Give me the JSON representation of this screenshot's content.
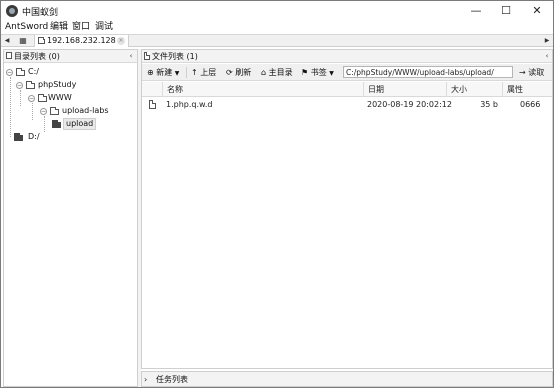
{
  "window": {
    "title": "中国蚁剑",
    "minimize": "—",
    "maximize": "☐",
    "close": "✕"
  },
  "menu": [
    "AntSword",
    "编辑",
    "窗口",
    "调试"
  ],
  "tabs": {
    "prev": "◀",
    "next": "▶",
    "home_icon": "▦",
    "active_label": "192.168.232.128",
    "close": "×"
  },
  "left_panel": {
    "title": "目录列表 (0)",
    "collapse": "‹",
    "tree": [
      {
        "label": "C:/",
        "toggle": "−"
      },
      {
        "label": "phpStudy",
        "toggle": "−"
      },
      {
        "label": "WWW",
        "toggle": "−"
      },
      {
        "label": "upload-labs",
        "toggle": "−"
      },
      {
        "label": "upload",
        "selected": true
      },
      {
        "label": "D:/"
      }
    ]
  },
  "right_panel": {
    "title": "文件列表 (1)",
    "collapse": "‹",
    "toolbar": {
      "new": "新建",
      "up": "上层",
      "refresh": "刷新",
      "home": "主目录",
      "bookmarks": "书签",
      "path": "C:/phpStudy/WWW/upload-labs/upload/",
      "read": "读取"
    },
    "columns": [
      "名称",
      "日期",
      "大小",
      "属性"
    ],
    "rows": [
      {
        "name": "1.php.q.w.d",
        "date": "2020-08-19 20:02:12",
        "size": "35 b",
        "attr": "0666"
      }
    ]
  },
  "task_panel": {
    "title": "任务列表",
    "expand": "›"
  },
  "icons": {
    "app": "antsword-icon",
    "file": "file-icon",
    "folder": "folder-icon"
  },
  "colors": {
    "panel_header": "#f3f3f3",
    "border": "#cfcfcf"
  }
}
